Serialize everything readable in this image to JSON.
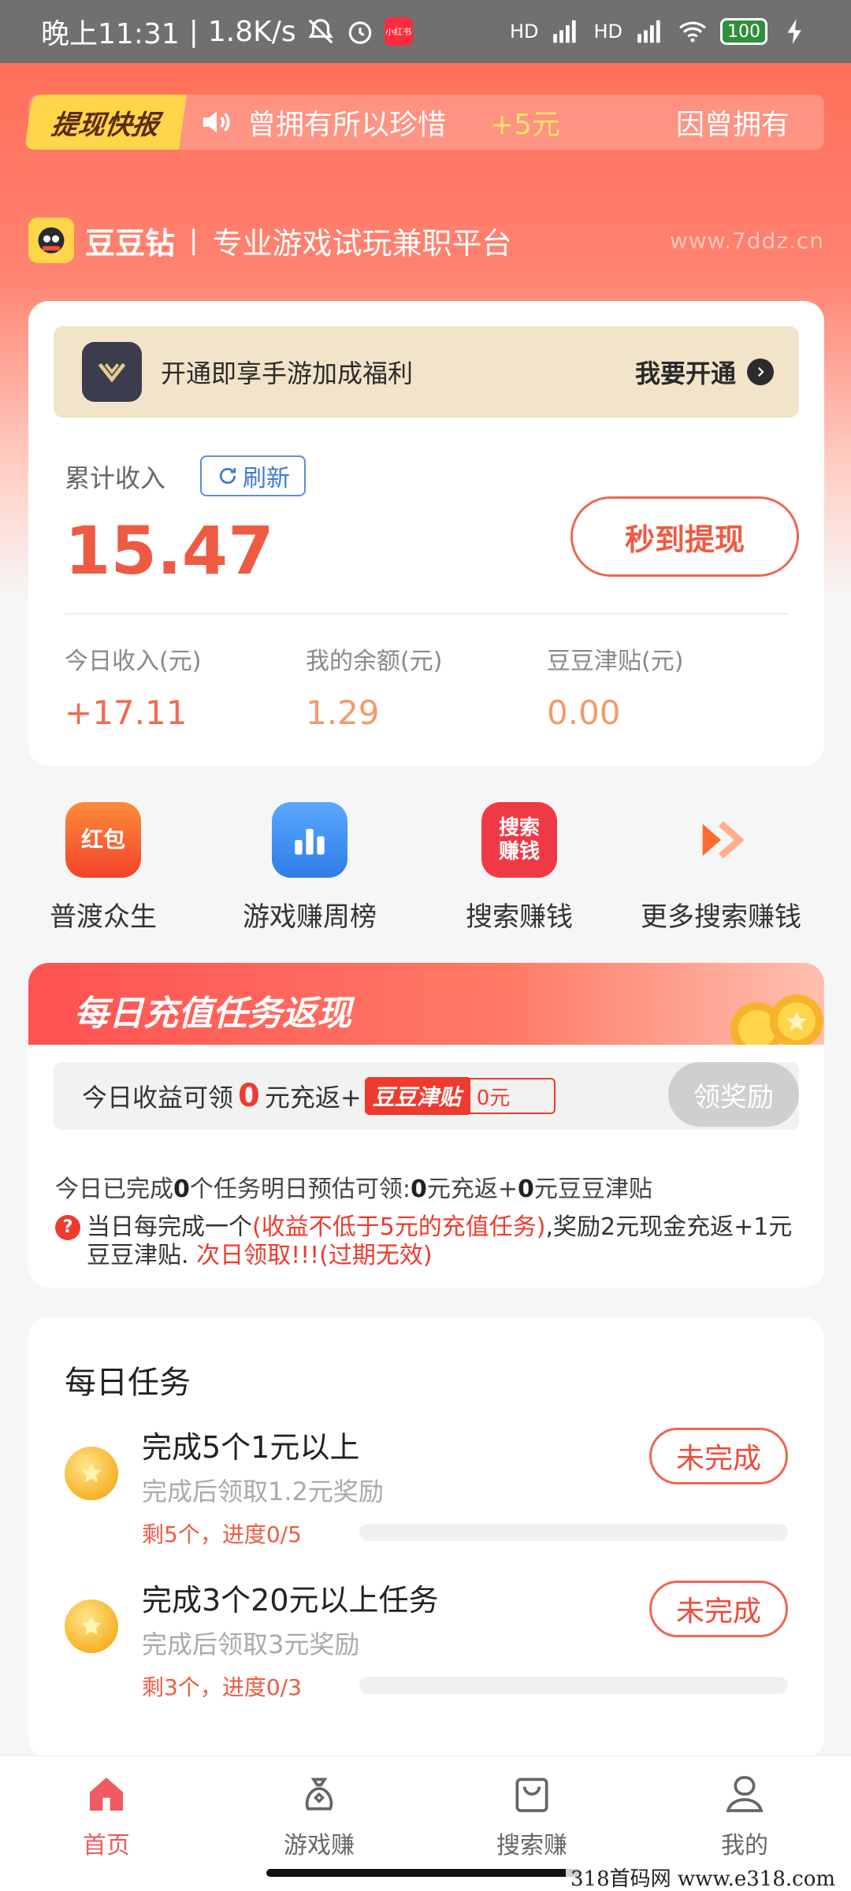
{
  "status_bar": {
    "time": "晚上11:31",
    "speed": "1.8K/s",
    "app_badge": "小红书",
    "signal1": "HD",
    "signal2": "HD",
    "battery": "100"
  },
  "ticker": {
    "badge": "提现快报",
    "message": "曾拥有所以珍惜",
    "amount": "+5元",
    "message2": "因曾拥有"
  },
  "brand": {
    "name": "豆豆钻",
    "slogan": "专业游戏试玩兼职平台",
    "url": "www.7ddz.cn"
  },
  "income": {
    "vip_text": "开通即享手游加成福利",
    "vip_action": "我要开通",
    "total_label": "累计收入",
    "refresh_label": "刷新",
    "total_value": "15.47",
    "withdraw_label": "秒到提现",
    "stats": [
      {
        "label": "今日收入(元)",
        "value": "+17.11"
      },
      {
        "label": "我的余额(元)",
        "value": "1.29"
      },
      {
        "label": "豆豆津贴(元)",
        "value": "0.00"
      }
    ]
  },
  "quick_menu": [
    {
      "label": "普渡众生",
      "icon": "red-packet-icon",
      "icon_text": "红包"
    },
    {
      "label": "游戏赚周榜",
      "icon": "ranking-chart-icon"
    },
    {
      "label": "搜索赚钱",
      "icon": "search-earn-icon",
      "icon_text1": "搜索",
      "icon_text2": "赚钱"
    },
    {
      "label": "更多搜索赚钱",
      "icon": "double-arrow-icon"
    }
  ],
  "recharge": {
    "title": "每日充值任务返现",
    "reward_prefix": "今日收益可领",
    "reward_zero": "0",
    "reward_mid": "元充返+",
    "tag_label": "豆豆津贴",
    "tag_value": "0元",
    "claim_label": "领奖励",
    "done_a": "今日已完成",
    "done_n1": "0",
    "done_b": "个任务明日预估可领:",
    "done_n2": "0",
    "done_c": "元充返+",
    "done_n3": "0",
    "done_d": "元豆豆津贴",
    "note_a": "当日每完成一个",
    "note_b": "(收益不低于5元的充值任务)",
    "note_c": ",奖励2元现金充返+1元豆豆津贴. ",
    "note_d": "次日领取!!!(过期无效)"
  },
  "daily_tasks": {
    "title": "每日任务",
    "items": [
      {
        "title": "完成5个1元以上",
        "sub": "完成后领取1.2元奖励",
        "progress": "剩5个，进度0/5",
        "fill": 0,
        "button": "未完成"
      },
      {
        "title": "完成3个20元以上任务",
        "sub": "完成后领取3元奖励",
        "progress": "剩3个，进度0/3",
        "fill": 0,
        "button": "未完成"
      }
    ]
  },
  "bottom_nav": [
    {
      "label": "首页",
      "icon": "home-icon",
      "active": true
    },
    {
      "label": "游戏赚",
      "icon": "money-bag-icon",
      "active": false
    },
    {
      "label": "搜索赚",
      "icon": "shopping-bag-icon",
      "active": false
    },
    {
      "label": "我的",
      "icon": "user-icon",
      "active": false
    }
  ],
  "watermark": "318首码网  www.e318.com",
  "colors": {
    "accent": "#ef5a43",
    "header_gradient_top": "#ff6a52",
    "nav_active": "#ef5a63"
  }
}
